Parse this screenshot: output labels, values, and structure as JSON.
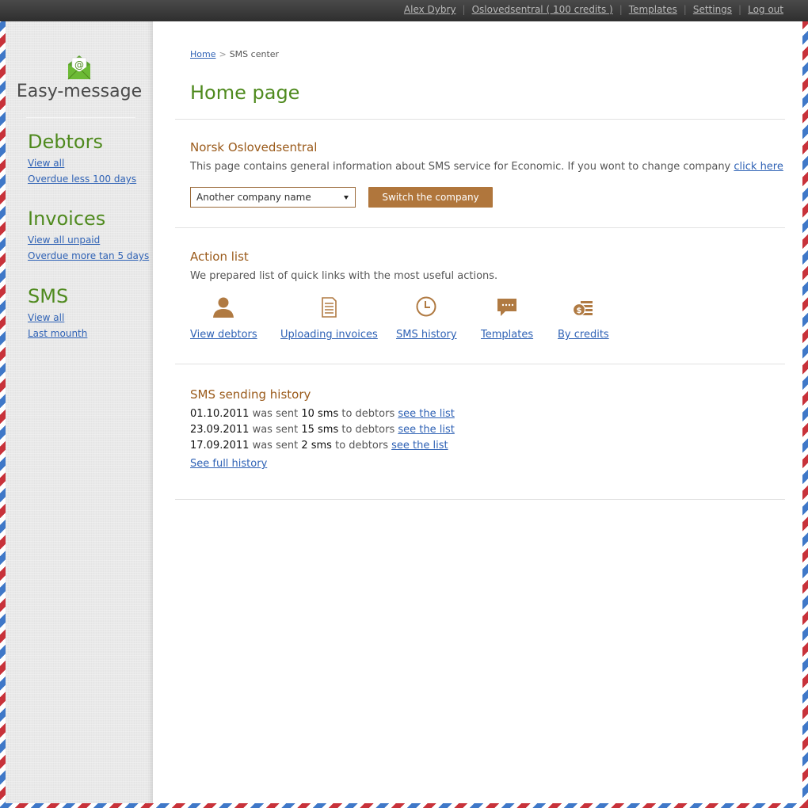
{
  "topnav": {
    "user": "Alex Dybry",
    "account": "Oslovedsentral ( 100 credits )",
    "templates": "Templates",
    "settings": "Settings",
    "logout": "Log out",
    "separator": "|"
  },
  "sidebar": {
    "logo_text": "Easy-message",
    "logo_icon": "envelope-at-icon",
    "sections": [
      {
        "title": "Debtors",
        "links": [
          "View all",
          "Overdue less 100 days"
        ]
      },
      {
        "title": "Invoices",
        "links": [
          "View all unpaid",
          "Overdue more tan 5 days"
        ]
      },
      {
        "title": "SMS",
        "links": [
          "View all",
          "Last mounth"
        ]
      }
    ]
  },
  "breadcrumb": {
    "home": "Home",
    "separator": ">",
    "current": "SMS center"
  },
  "page_title": "Home page",
  "company": {
    "title": "Norsk Oslovedsentral",
    "description": "This page contains general information about SMS service for Economic. If you wont to change company",
    "link": "click here",
    "select_value": "Another company name",
    "button": "Switch the company"
  },
  "actions": {
    "title": "Action list",
    "description": "We prepared list of quick links with the most useful actions.",
    "items": [
      {
        "label": "View debtors",
        "icon": "user-icon"
      },
      {
        "label": "Uploading invoices",
        "icon": "document-icon"
      },
      {
        "label": "SMS history",
        "icon": "clock-icon"
      },
      {
        "label": "Templates",
        "icon": "speech-bubble-icon"
      },
      {
        "label": "By credits",
        "icon": "coins-icon"
      }
    ]
  },
  "history": {
    "title": "SMS sending history",
    "rows": [
      {
        "date": "01.10.2011",
        "was_sent": "was sent",
        "count": "10 sms",
        "to": "to debtors",
        "link": "see the list"
      },
      {
        "date": "23.09.2011",
        "was_sent": "was sent",
        "count": "15 sms",
        "to": "to debtors",
        "link": "see the list"
      },
      {
        "date": "17.09.2011",
        "was_sent": "was sent",
        "count": "2 sms",
        "to": "to debtors",
        "link": "see the list"
      }
    ],
    "full_link": "See full history"
  },
  "colors": {
    "accent_green": "#4f8a1e",
    "section_brown": "#9a5a1a",
    "button_brown": "#b0763c",
    "link_blue": "#2f62b5",
    "icon_brown": "#b07a42"
  }
}
